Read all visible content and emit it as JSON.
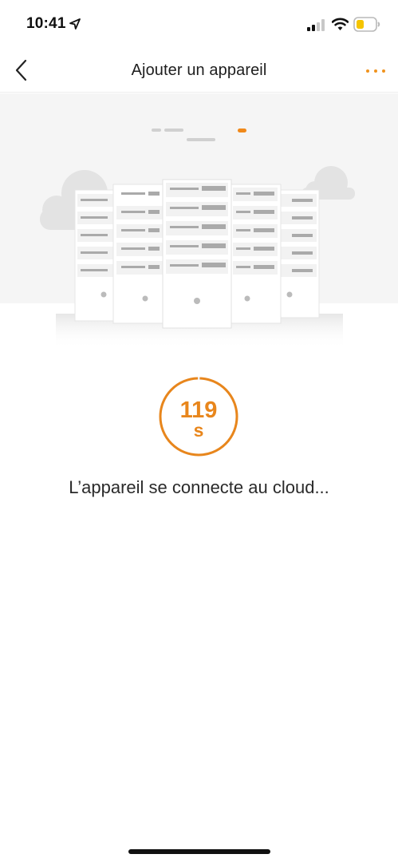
{
  "status_bar": {
    "time": "10:41",
    "icons": [
      "location-arrow-icon",
      "cellular-signal-icon",
      "wifi-icon",
      "battery-low-icon"
    ],
    "battery_color": "#f5c400"
  },
  "nav": {
    "title": "Ajouter un appareil",
    "back_icon": "chevron-left-icon",
    "more_icon": "more-horizontal-icon"
  },
  "illustration": {
    "name": "server-racks-cloud",
    "step_indicator": {
      "steps": 4,
      "active": 4
    }
  },
  "countdown": {
    "value": "119",
    "unit": "s",
    "progress": 0.99
  },
  "message": "L’appareil se connecte au cloud...",
  "colors": {
    "accent": "#e8861c",
    "hero_background": "#f5f5f5"
  }
}
